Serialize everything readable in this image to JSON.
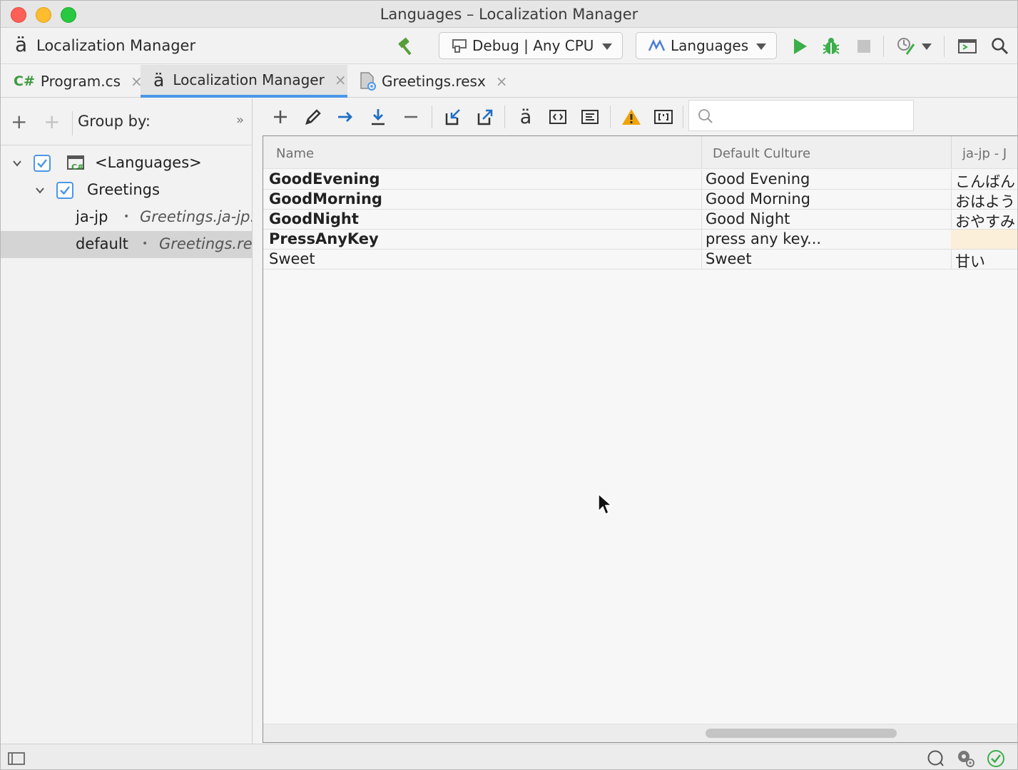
{
  "window": {
    "title": "Languages – Localization Manager"
  },
  "toolbar": {
    "app_icon_glyph": "ä",
    "app_name": "Localization Manager",
    "config_combo": "Debug | Any CPU",
    "project_combo": "Languages"
  },
  "tabs": [
    {
      "badge": "C#",
      "label": "Program.cs",
      "close": "×"
    },
    {
      "badge": "ä",
      "label": "Localization Manager",
      "close": "×"
    },
    {
      "badge": "",
      "label": "Greetings.resx",
      "close": "×"
    }
  ],
  "left_pane": {
    "add_glyph": "+",
    "add_group_glyph": "+",
    "group_by_label": "Group by:",
    "more_glyph": "»",
    "tree": {
      "root_label": "<Languages>",
      "group_label": "Greetings",
      "items": [
        {
          "culture": "ja-jp",
          "file": "Greetings.ja-jp.resx"
        },
        {
          "culture": "default",
          "file": "Greetings.resx"
        }
      ]
    }
  },
  "right_toolbar": {
    "localize_glyph": "ä",
    "search_placeholder": ""
  },
  "grid": {
    "columns": [
      "Name",
      "Default Culture",
      "ja-jp - J"
    ],
    "rows": [
      {
        "name": "GoodEvening",
        "default": "Good Evening",
        "ja": "こんばん"
      },
      {
        "name": "GoodMorning",
        "default": "Good Morning",
        "ja": "おはよう"
      },
      {
        "name": "GoodNight",
        "default": "Good Night",
        "ja": "おやすみ"
      },
      {
        "name": "PressAnyKey",
        "default": "press any key...",
        "ja": ""
      },
      {
        "name": "Sweet",
        "default": "Sweet",
        "ja": "甘い"
      }
    ]
  },
  "colors": {
    "accent": "#4b97e8",
    "run_green": "#3cae4a",
    "warning": "#f0a30a",
    "missing_cell": "#fcefd9"
  }
}
